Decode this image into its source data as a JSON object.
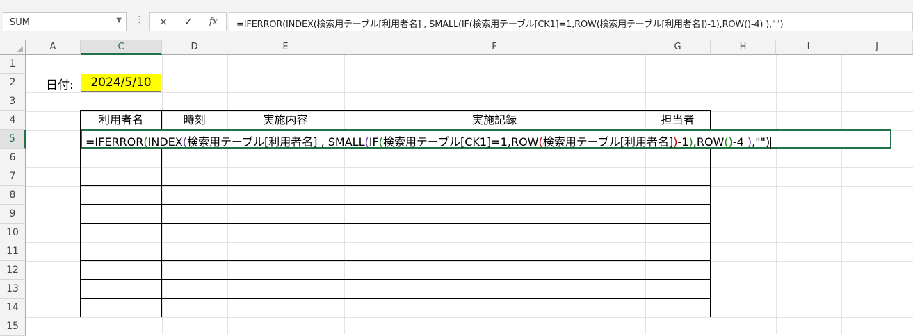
{
  "name_box": {
    "value": "SUM"
  },
  "formula_bar": {
    "cancel_icon": "×",
    "enter_icon": "✓",
    "fx_label": "fx",
    "formula": "=IFERROR(INDEX(検索用テーブル[利用者名] , SMALL(IF(検索用テーブル[CK1]=1,ROW(検索用テーブル[利用者名])-1),ROW()-4) ),\"\")"
  },
  "columns": [
    "A",
    "C",
    "D",
    "E",
    "F",
    "G",
    "H",
    "I",
    "J"
  ],
  "rows": [
    "1",
    "2",
    "3",
    "4",
    "5",
    "6",
    "7",
    "8",
    "9",
    "10",
    "11",
    "12",
    "13",
    "14",
    "15"
  ],
  "active_column": "C",
  "active_row": "5",
  "date_label": "日付:",
  "date_value": "2024/5/10",
  "table": {
    "headers": [
      "利用者名",
      "時刻",
      "実施内容",
      "実施記録",
      "担当者"
    ]
  },
  "editing_cell": {
    "parts": {
      "p1": "=IFERROR",
      "p2": "(",
      "p3": "INDEX",
      "p4": "(",
      "p5": "検索用テーブル[利用者名] , SMALL",
      "p6": "(",
      "p7": "IF",
      "p8": "(",
      "p9": "検索用テーブル[CK1]=1,ROW",
      "p10": "(",
      "p11": "検索用テーブル[利用者名]",
      "p12": ")",
      "p13": "-1",
      "p14": ")",
      "p15": ",ROW",
      "p16": "()",
      "p17": "-4",
      "p18": " )",
      "p19": ",\"\"",
      "p20": ")"
    }
  },
  "colors": {
    "accent": "#217346",
    "date_fill": "#ffff00"
  }
}
